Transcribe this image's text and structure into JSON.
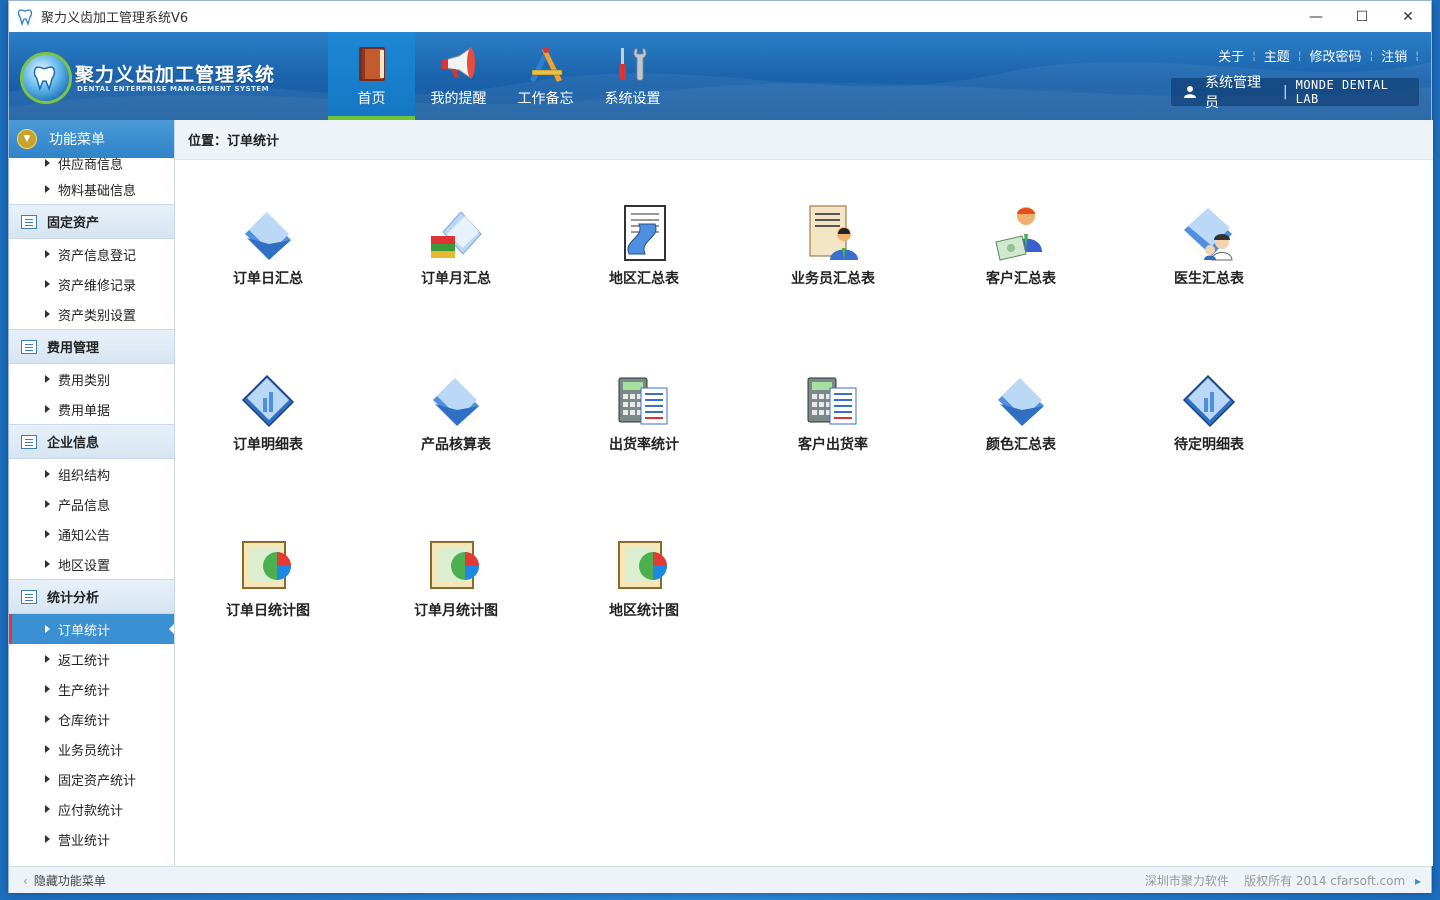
{
  "window": {
    "title": "聚力义齿加工管理系统V6",
    "controls": {
      "minimize": "—",
      "maximize": "☐",
      "close": "✕"
    }
  },
  "header": {
    "logo_title": "聚力义齿加工管理系统",
    "logo_subtitle": "DENTAL ENTERPRISE MANAGEMENT SYSTEM",
    "nav": [
      {
        "label": "首页",
        "icon": "book-icon",
        "active": true
      },
      {
        "label": "我的提醒",
        "icon": "megaphone-icon",
        "active": false
      },
      {
        "label": "工作备忘",
        "icon": "tools-ruler-icon",
        "active": false
      },
      {
        "label": "系统设置",
        "icon": "screwdriver-wrench-icon",
        "active": false
      }
    ],
    "links": [
      "关于",
      "主题",
      "修改密码",
      "注销"
    ],
    "user": {
      "name": "系统管理员",
      "company": "MONDE DENTAL LAB",
      "icon": "user-icon"
    }
  },
  "sidebar": {
    "title": "功能菜单",
    "top_items": [
      "供应商信息",
      "物料基础信息"
    ],
    "groups": [
      {
        "label": "固定资产",
        "items": [
          "资产信息登记",
          "资产维修记录",
          "资产类别设置"
        ]
      },
      {
        "label": "费用管理",
        "items": [
          "费用类别",
          "费用单据"
        ]
      },
      {
        "label": "企业信息",
        "items": [
          "组织结构",
          "产品信息",
          "通知公告",
          "地区设置"
        ]
      },
      {
        "label": "统计分析",
        "items": [
          "订单统计",
          "返工统计",
          "生产统计",
          "仓库统计",
          "业务员统计",
          "固定资产统计",
          "应付款统计",
          "营业统计"
        ]
      }
    ],
    "active_item": "订单统计"
  },
  "content": {
    "breadcrumb": "位置：订单统计",
    "tiles": [
      {
        "label": "订单日汇总",
        "icon": "folder-blue-icon"
      },
      {
        "label": "订单月汇总",
        "icon": "folder-books-icon"
      },
      {
        "label": "地区汇总表",
        "icon": "document-scroll-icon"
      },
      {
        "label": "业务员汇总表",
        "icon": "salesman-document-icon"
      },
      {
        "label": "客户汇总表",
        "icon": "customer-money-icon"
      },
      {
        "label": "医生汇总表",
        "icon": "doctor-folder-icon"
      },
      {
        "label": "订单明细表",
        "icon": "folder-chart-icon"
      },
      {
        "label": "产品核算表",
        "icon": "folder-blue-icon"
      },
      {
        "label": "出货率统计",
        "icon": "calculator-report-icon"
      },
      {
        "label": "客户出货率",
        "icon": "calculator-report-icon"
      },
      {
        "label": "颜色汇总表",
        "icon": "folder-blue-icon"
      },
      {
        "label": "待定明细表",
        "icon": "folder-chart-icon"
      },
      {
        "label": "订单日统计图",
        "icon": "pie-chart-sheet-icon"
      },
      {
        "label": "订单月统计图",
        "icon": "pie-chart-sheet-icon"
      },
      {
        "label": "地区统计图",
        "icon": "pie-chart-sheet-icon"
      }
    ]
  },
  "statusbar": {
    "hide_menu": "隐藏功能菜单",
    "company": "深圳市聚力软件",
    "copyright": "版权所有 2014 cfarsoft.com"
  }
}
